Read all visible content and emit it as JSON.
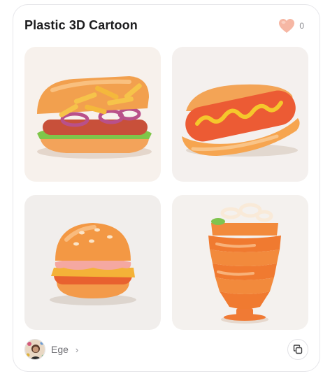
{
  "card": {
    "title": "Plastic 3D Cartoon",
    "like_count": "0",
    "like_icon": "heart-icon",
    "author": {
      "name": "Ege",
      "chevron": "›",
      "avatar_icon": "avatar"
    },
    "copy_icon": "copy-icon"
  },
  "images": [
    {
      "subject": "sandwich-with-fries"
    },
    {
      "subject": "hot-dog"
    },
    {
      "subject": "burger"
    },
    {
      "subject": "kebab"
    }
  ],
  "colors": {
    "heart": "#f6b7a4",
    "orange": "#f47a2c",
    "bun": "#f5a14c"
  }
}
